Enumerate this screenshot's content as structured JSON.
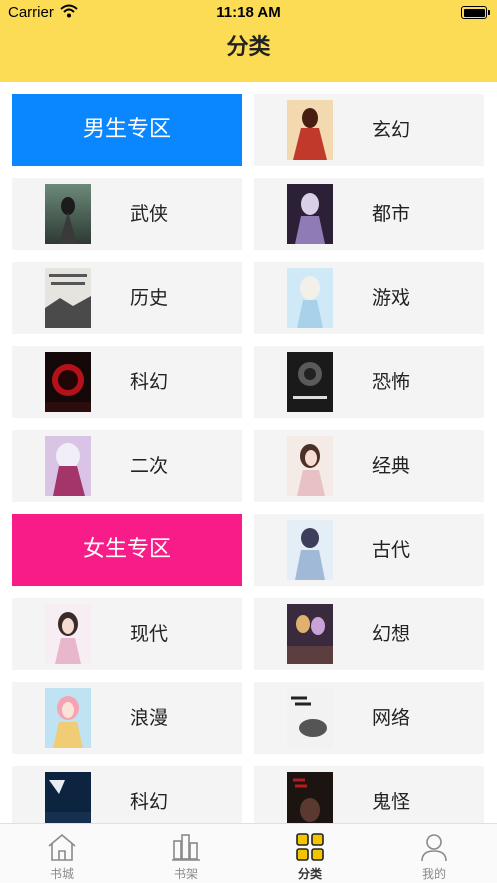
{
  "status_bar": {
    "carrier": "Carrier",
    "time": "11:18 AM"
  },
  "nav": {
    "title": "分类"
  },
  "sections": {
    "male": {
      "label": "男生专区",
      "color": "#0A86FF"
    },
    "female": {
      "label": "女生专区",
      "color": "#F81C89"
    }
  },
  "left_categories": [
    "武侠",
    "历史",
    "科幻",
    "二次",
    "现代",
    "浪漫",
    "科幻"
  ],
  "right_categories": [
    "玄幻",
    "都市",
    "游戏",
    "恐怖",
    "经典",
    "古代",
    "幻想",
    "网络",
    "鬼怪"
  ],
  "tabs": [
    {
      "label": "书城",
      "icon": "home-icon"
    },
    {
      "label": "书架",
      "icon": "bookshelf-icon"
    },
    {
      "label": "分类",
      "icon": "category-grid-icon",
      "active": true
    },
    {
      "label": "我的",
      "icon": "user-icon"
    }
  ],
  "colors": {
    "header": "#FCDC54",
    "tile_bg": "#F4F4F4",
    "active_icon": "#F5C400"
  }
}
